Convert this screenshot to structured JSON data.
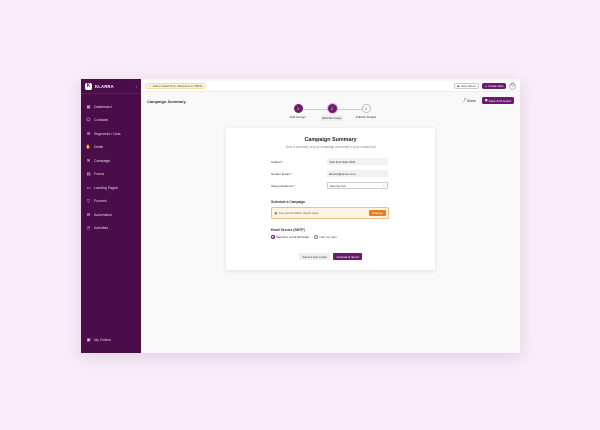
{
  "sidebar": {
    "brand": "KLARRA",
    "logo_letter": "K",
    "items": [
      {
        "label": "Dashboard",
        "icon": "dashboard-icon"
      },
      {
        "label": "Contacts",
        "icon": "contacts-icon"
      },
      {
        "label": "Segments / Lists",
        "icon": "segments-icon"
      },
      {
        "label": "Deals",
        "icon": "deals-icon"
      },
      {
        "label": "Campaign",
        "icon": "campaign-icon"
      },
      {
        "label": "Forms",
        "icon": "forms-icon"
      },
      {
        "label": "Landing Pages",
        "icon": "landing-pages-icon"
      },
      {
        "label": "Funnels",
        "icon": "funnels-icon"
      },
      {
        "label": "Automation",
        "icon": "automation-icon"
      },
      {
        "label": "Activities",
        "icon": "activities-icon"
      }
    ],
    "footer": {
      "label": "My Orders",
      "icon": "orders-icon"
    }
  },
  "topbar": {
    "banner": "Jaime David M.G. Welcome to CRMe",
    "help": "Help videos",
    "create": "Create New"
  },
  "page": {
    "title": "Campaign Summary",
    "share": "Share",
    "save_proceed": "Save & Proceed"
  },
  "steps": [
    {
      "num": "1",
      "label": "Edit Design",
      "state": "done"
    },
    {
      "num": "2",
      "label": "Edit Summary",
      "state": "current"
    },
    {
      "num": "3",
      "label": "Publish Details",
      "state": "todo"
    }
  ],
  "card": {
    "title": "Campaign Summary",
    "subtitle": "View a summary of your campaign and email to your contact list",
    "fields": [
      {
        "label": "Subject *",
        "value": "Year End Sale 2021",
        "kind": "input"
      },
      {
        "label": "Sender Email *",
        "value": "abcsub@acme.com",
        "kind": "input"
      },
      {
        "label": "Target Audience *",
        "value": "Monroe List",
        "kind": "select"
      }
    ],
    "schedule_heading": "Schedule a Campaign",
    "schedule_text": "Tue Jan 04 2022, (Send now)",
    "change": "Change",
    "email_service_heading": "Email Service (SMTP)",
    "radios": [
      {
        "label": "Bamboo email (Default)",
        "checked": true
      },
      {
        "label": "Use my own",
        "checked": false
      }
    ],
    "send_test": "Send a test email",
    "activate": "Activate & Send"
  },
  "colors": {
    "brand": "#6a1b6a",
    "sidebar": "#4a0d4a",
    "warning": "#e67e22"
  }
}
